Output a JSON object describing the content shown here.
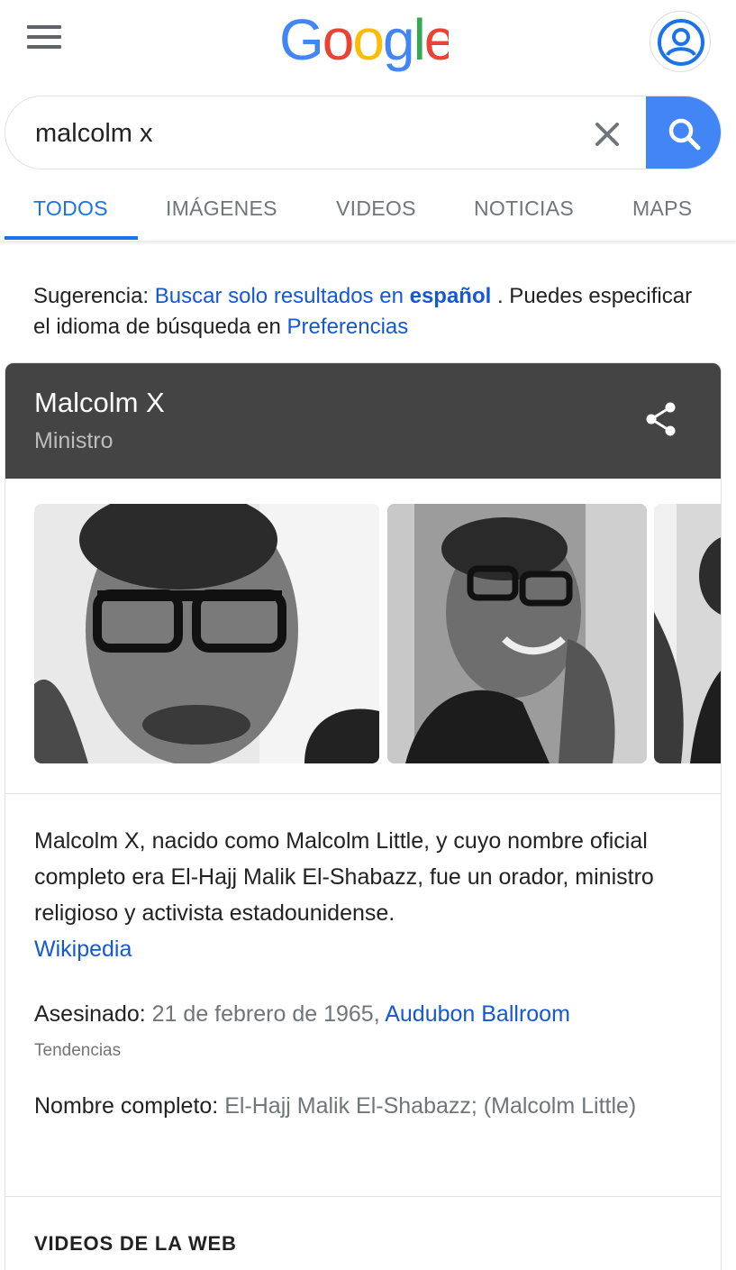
{
  "header": {
    "logo_text": "Google"
  },
  "search": {
    "query": "malcolm x"
  },
  "tabs": [
    {
      "label": "TODOS"
    },
    {
      "label": "IMÁGENES"
    },
    {
      "label": "VIDEOS"
    },
    {
      "label": "NOTICIAS"
    },
    {
      "label": "MAPS"
    }
  ],
  "suggestion": {
    "prefix": "Sugerencia:",
    "link_text": "Buscar solo resultados en",
    "link_bold": "español",
    "middle": ". Puedes especificar el idioma de búsqueda en",
    "pref_link": "Preferencias"
  },
  "panel": {
    "title": "Malcolm X",
    "subtitle": "Ministro",
    "description": "Malcolm X, nacido como Malcolm Little, y cuyo nombre oficial completo era El-Hajj Malik El-Shabazz, fue un orador, ministro religioso y activista estadounidense.",
    "source_link": "Wikipedia",
    "facts": {
      "death_label": "Asesinado:",
      "death_value": "21 de febrero de 1965,",
      "death_link": "Audubon Ballroom",
      "trend_label": "Tendencias",
      "name_label": "Nombre completo:",
      "name_value": "El-Hajj Malik El-Shabazz; (Malcolm Little)"
    },
    "videos_title": "VIDEOS DE LA WEB"
  },
  "colors": {
    "accent": "#1a73e8",
    "link": "#1558d6",
    "search_button": "#4285f4",
    "panel_header": "#444444"
  }
}
